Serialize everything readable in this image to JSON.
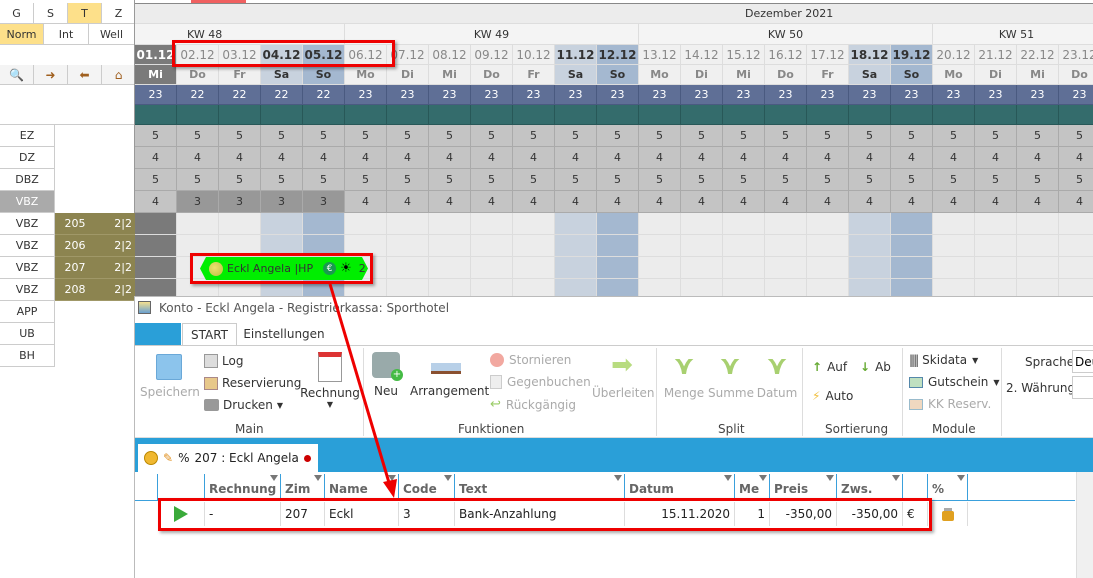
{
  "left_panel": {
    "view_tabs": [
      "G",
      "S",
      "T",
      "Z"
    ],
    "active_view_tab": "T",
    "mode_tabs": [
      "Norm",
      "Int",
      "Well"
    ],
    "active_mode_tab": "Norm",
    "tool_icons": [
      "search-icon",
      "door-enter-icon",
      "door-exit-icon",
      "home-icon"
    ],
    "category_rows": [
      "EZ",
      "DZ",
      "DBZ",
      "VBZ"
    ],
    "room_rows": [
      {
        "type": "VBZ",
        "room": "205",
        "occ": "2|2"
      },
      {
        "type": "VBZ",
        "room": "206",
        "occ": "2|2"
      },
      {
        "type": "VBZ",
        "room": "207",
        "occ": "2|2"
      },
      {
        "type": "VBZ",
        "room": "208",
        "occ": "2|2"
      }
    ],
    "extra_rows": [
      "APP",
      "UB",
      "BH"
    ]
  },
  "calendar": {
    "month": "Dezember 2021",
    "weeks": [
      {
        "label": "KW 48",
        "days": 5
      },
      {
        "label": "KW 49",
        "days": 7
      },
      {
        "label": "KW 50",
        "days": 7
      },
      {
        "label": "KW 51",
        "days": 4
      }
    ],
    "dates": [
      "01.12",
      "02.12",
      "03.12",
      "04.12",
      "05.12",
      "06.12",
      "07.12",
      "08.12",
      "09.12",
      "10.12",
      "11.12",
      "12.12",
      "13.12",
      "14.12",
      "15.12",
      "16.12",
      "17.12",
      "18.12",
      "19.12",
      "20.12",
      "21.12",
      "22.12",
      "23.12"
    ],
    "weekdays": [
      "Mi",
      "Do",
      "Fr",
      "Sa",
      "So",
      "Mo",
      "Di",
      "Mi",
      "Do",
      "Fr",
      "Sa",
      "So",
      "Mo",
      "Di",
      "Mi",
      "Do",
      "Fr",
      "Sa",
      "So",
      "Mo",
      "Di",
      "Mi",
      "Do"
    ],
    "totals": [
      23,
      22,
      22,
      22,
      22,
      23,
      23,
      23,
      23,
      23,
      23,
      23,
      23,
      23,
      23,
      23,
      23,
      23,
      23,
      23,
      23,
      23,
      23
    ],
    "availability": {
      "EZ": [
        5,
        5,
        5,
        5,
        5,
        5,
        5,
        5,
        5,
        5,
        5,
        5,
        5,
        5,
        5,
        5,
        5,
        5,
        5,
        5,
        5,
        5,
        5
      ],
      "DZ": [
        4,
        4,
        4,
        4,
        4,
        4,
        4,
        4,
        4,
        4,
        4,
        4,
        4,
        4,
        4,
        4,
        4,
        4,
        4,
        4,
        4,
        4,
        4
      ],
      "DBZ": [
        5,
        5,
        5,
        5,
        5,
        5,
        5,
        5,
        5,
        5,
        5,
        5,
        5,
        5,
        5,
        5,
        5,
        5,
        5,
        5,
        5,
        5,
        5
      ],
      "VBZ": [
        4,
        3,
        3,
        3,
        3,
        4,
        4,
        4,
        4,
        4,
        4,
        4,
        4,
        4,
        4,
        4,
        4,
        4,
        4,
        4,
        4,
        4,
        4
      ]
    },
    "booking": {
      "label": "Eckl Angela |HP",
      "count": "2",
      "color": "#00ee00"
    }
  },
  "dialog": {
    "title": "Konto - Eckl Angela - Registrierkassa: Sporthotel",
    "tabs": [
      "START",
      "Einstellungen"
    ],
    "active_tab": "START",
    "ribbon": {
      "main": {
        "label": "Main",
        "speichern": "Speichern",
        "log": "Log",
        "reservierung": "Reservierung",
        "drucken": "Drucken",
        "rechnung": "Rechnung"
      },
      "funktionen": {
        "label": "Funktionen",
        "neu": "Neu",
        "arrangement": "Arrangement",
        "stornieren": "Stornieren",
        "gegenbuchen": "Gegenbuchen",
        "rueckgaengig": "Rückgängig",
        "ueberleiten": "Überleiten"
      },
      "split": {
        "label": "Split",
        "menge": "Menge",
        "summe": "Summe",
        "datum": "Datum"
      },
      "sortierung": {
        "label": "Sortierung",
        "auf": "Auf",
        "ab": "Ab",
        "auto": "Auto"
      },
      "module": {
        "label": "Module",
        "skidata": "Skidata",
        "gutschein": "Gutschein",
        "kk": "KK Reserv."
      },
      "sprache_label": "Sprache",
      "sprache_value": "Deu",
      "waehrung_label": "2. Währung",
      "waehrung_value": ""
    },
    "account_tab": {
      "prefix": "%",
      "label": "207 :  Eckl Angela"
    },
    "table": {
      "columns": [
        "Rechnung",
        "Zim",
        "Name",
        "Code",
        "Text",
        "Datum",
        "Me",
        "Preis",
        "Zws.",
        "",
        "%"
      ],
      "rows": [
        {
          "rechnung": "-",
          "zim": "207",
          "name": "Eckl",
          "code": "3",
          "text": "Bank-Anzahlung",
          "datum": "15.11.2020",
          "me": "1",
          "preis": "-350,00",
          "zws": "-350,00",
          "currency": "€"
        }
      ]
    }
  },
  "colors": {
    "annotation": "#e00000",
    "ribbon_blue": "#2a9fd8",
    "total_row": "#5f6f96",
    "teal_row": "#346c6c",
    "room_olive": "#8c8450",
    "highlight": "#fde08a"
  }
}
